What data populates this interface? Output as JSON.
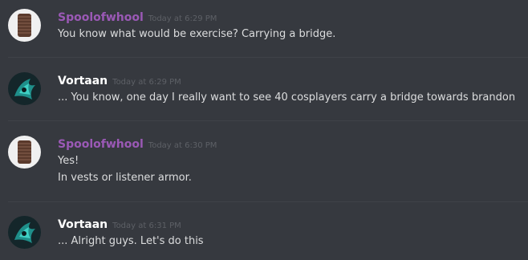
{
  "colors": {
    "background": "#36393f",
    "divider": "#3f4248",
    "spool_author": "#9b59b6",
    "vortaan_author": "#ffffff",
    "message_text": "#dcddde",
    "timestamp": "#5d6066"
  },
  "messages": [
    {
      "author": "Spoolofwhool",
      "timestamp": "Today at 6:29 PM",
      "avatar_icon": "spool-avatar-icon",
      "lines": [
        "You know what would be exercise? Carrying a bridge."
      ]
    },
    {
      "author": "Vortaan",
      "timestamp": "Today at 6:29 PM",
      "avatar_icon": "vortaan-avatar-icon",
      "lines": [
        "... You know, one day I really want to see 40 cosplayers carry a bridge towards brandon"
      ]
    },
    {
      "author": "Spoolofwhool",
      "timestamp": "Today at 6:30 PM",
      "avatar_icon": "spool-avatar-icon",
      "lines": [
        "Yes!",
        "In vests or listener armor."
      ]
    },
    {
      "author": "Vortaan",
      "timestamp": "Today at 6:31 PM",
      "avatar_icon": "vortaan-avatar-icon",
      "lines": [
        "... Alright guys. Let's do this"
      ]
    }
  ]
}
